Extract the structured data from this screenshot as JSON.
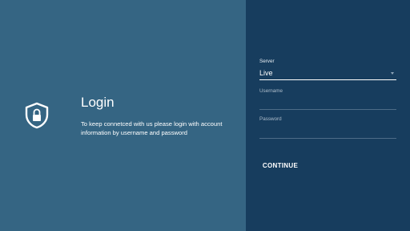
{
  "login": {
    "title": "Login",
    "description": "To keep connetced with us please login with account information by username and password",
    "icon": "shield-lock-icon"
  },
  "form": {
    "server_label": "Server",
    "server_value": "Live",
    "username_label": "Username",
    "username_value": "",
    "password_label": "Password",
    "password_value": "",
    "continue_label": "CONTINUE"
  },
  "colors": {
    "left_panel": "#356583",
    "right_panel": "#173d5e",
    "text": "#ffffff"
  }
}
